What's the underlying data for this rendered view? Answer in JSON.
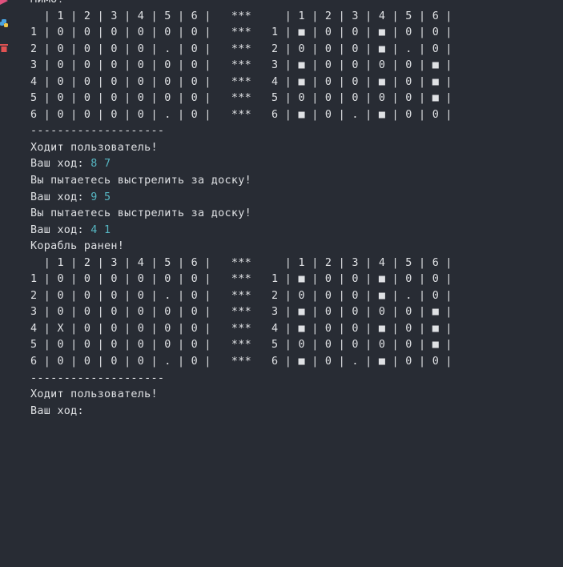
{
  "console": {
    "top_line": "Мимо!",
    "block1": {
      "header": "  | 1 | 2 | 3 | 4 | 5 | 6 |   ***     | 1 | 2 | 3 | 4 | 5 | 6 |",
      "rows": [
        "1 | 0 | 0 | 0 | 0 | 0 | 0 |   ***   1 | ■ | 0 | 0 | ■ | 0 | 0 |",
        "2 | 0 | 0 | 0 | 0 | . | 0 |   ***   2 | 0 | 0 | 0 | ■ | . | 0 |",
        "3 | 0 | 0 | 0 | 0 | 0 | 0 |   ***   3 | ■ | 0 | 0 | 0 | 0 | ■ |",
        "4 | 0 | 0 | 0 | 0 | 0 | 0 |   ***   4 | ■ | 0 | 0 | ■ | 0 | ■ |",
        "5 | 0 | 0 | 0 | 0 | 0 | 0 |   ***   5 | 0 | 0 | 0 | 0 | 0 | ■ |",
        "6 | 0 | 0 | 0 | 0 | . | 0 |   ***   6 | ■ | 0 | . | ■ | 0 | 0 |"
      ]
    },
    "separator": "--------------------",
    "turn_msg": "Ходит пользователь!",
    "prompt": "Ваш ход: ",
    "moves": [
      {
        "input": "8 7",
        "result": "Вы пытаетесь выстрелить за доску!"
      },
      {
        "input": "9 5",
        "result": "Вы пытаетесь выстрелить за доску!"
      },
      {
        "input": "4 1",
        "result": "Корабль ранен!"
      }
    ],
    "block2": {
      "header": "  | 1 | 2 | 3 | 4 | 5 | 6 |   ***     | 1 | 2 | 3 | 4 | 5 | 6 |",
      "rows": [
        "1 | 0 | 0 | 0 | 0 | 0 | 0 |   ***   1 | ■ | 0 | 0 | ■ | 0 | 0 |",
        "2 | 0 | 0 | 0 | 0 | . | 0 |   ***   2 | 0 | 0 | 0 | ■ | . | 0 |",
        "3 | 0 | 0 | 0 | 0 | 0 | 0 |   ***   3 | ■ | 0 | 0 | 0 | 0 | ■ |",
        "4 | X | 0 | 0 | 0 | 0 | 0 |   ***   4 | ■ | 0 | 0 | ■ | 0 | ■ |",
        "5 | 0 | 0 | 0 | 0 | 0 | 0 |   ***   5 | 0 | 0 | 0 | 0 | 0 | ■ |",
        "6 | 0 | 0 | 0 | 0 | . | 0 |   ***   6 | ■ | 0 | . | ■ | 0 | 0 |"
      ]
    },
    "separator2": "--------------------",
    "turn_msg2": "Ходит пользователь!",
    "prompt2": "Ваш ход:"
  },
  "gutter_icons": [
    "run-arrow-icon",
    "python-icon",
    "trash-icon"
  ],
  "colors": {
    "background": "#282c34",
    "text": "#dfe1e4",
    "input": "#56b6c2",
    "arrow": "#e0527e",
    "python": "#4aa3e0",
    "trash": "#e05252"
  }
}
